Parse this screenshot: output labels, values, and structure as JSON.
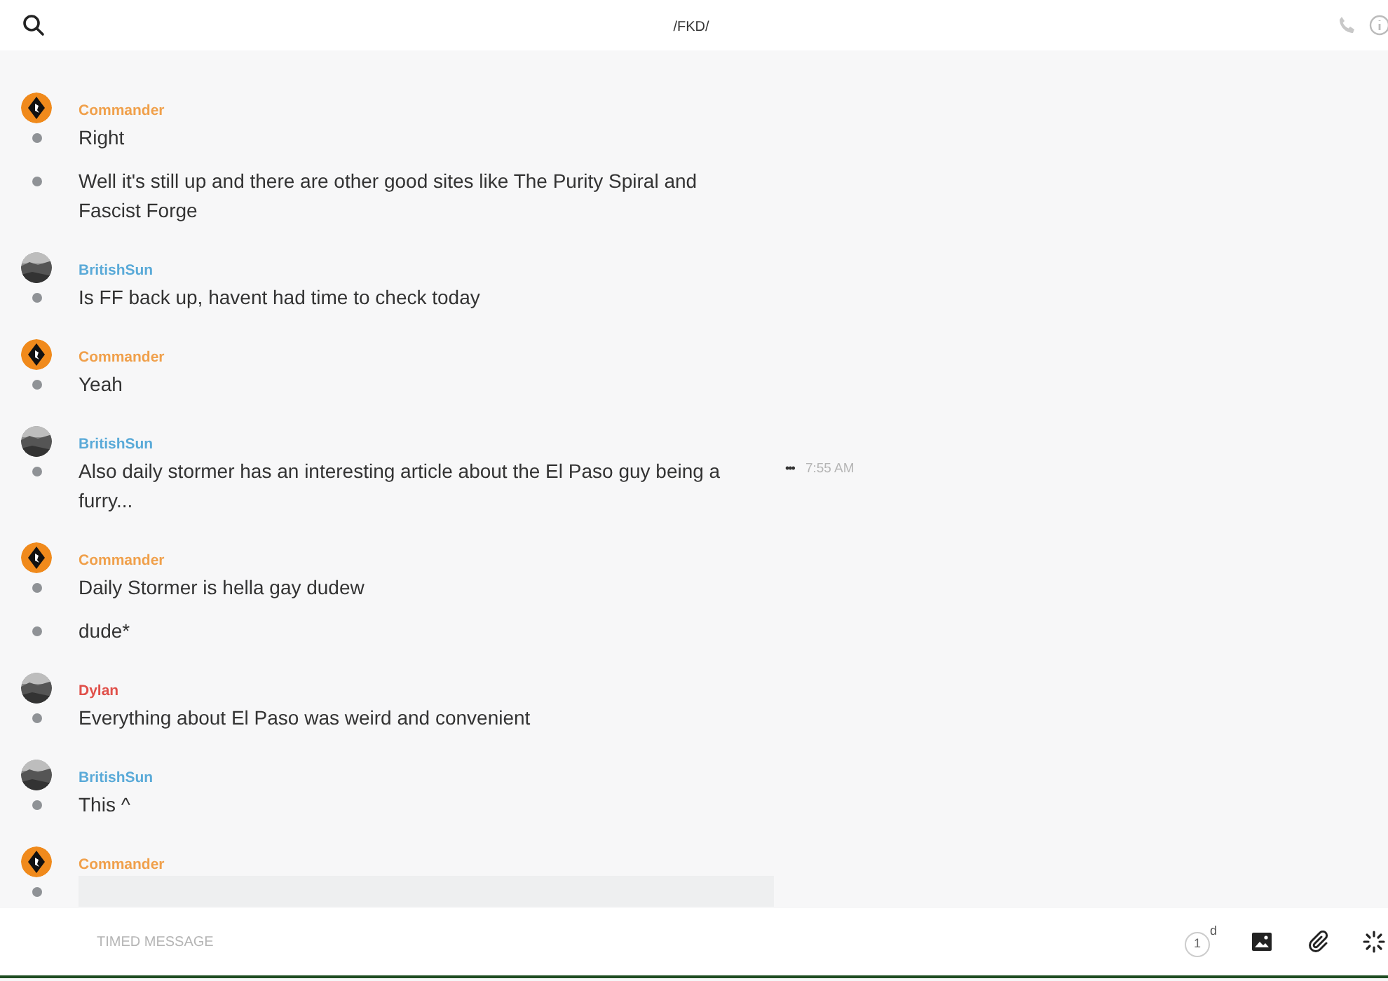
{
  "header": {
    "title": "/FKD/"
  },
  "groups": [
    {
      "author": "Commander",
      "color": "#f0a04b",
      "kind": "logo",
      "messages": [
        {
          "kind": "text",
          "text": "Right"
        },
        {
          "kind": "text",
          "text": "Well it's still up and there are other good sites like The Purity Spiral and Fascist Forge"
        }
      ]
    },
    {
      "author": "BritishSun",
      "color": "#5aaad8",
      "kind": "photo",
      "messages": [
        {
          "kind": "text",
          "text": "Is FF back up, havent had time to check today"
        }
      ]
    },
    {
      "author": "Commander",
      "color": "#f0a04b",
      "kind": "logo",
      "messages": [
        {
          "kind": "text",
          "text": "Yeah"
        }
      ]
    },
    {
      "author": "BritishSun",
      "color": "#5aaad8",
      "kind": "photo",
      "messages": [
        {
          "kind": "text",
          "text": "Also daily stormer has an interesting article about the El Paso guy being a furry...",
          "more": "•••",
          "time": "7:55 AM"
        }
      ]
    },
    {
      "author": "Commander",
      "color": "#f0a04b",
      "kind": "logo",
      "messages": [
        {
          "kind": "text",
          "text": "Daily Stormer is hella gay dudew"
        },
        {
          "kind": "text",
          "text": "dude*"
        }
      ]
    },
    {
      "author": "Dylan",
      "color": "#e0504a",
      "kind": "photo",
      "messages": [
        {
          "kind": "text",
          "text": "Everything about El Paso was weird and convenient"
        }
      ]
    },
    {
      "author": "BritishSun",
      "color": "#5aaad8",
      "kind": "photo",
      "messages": [
        {
          "kind": "text",
          "text": "This ^"
        }
      ]
    },
    {
      "author": "Commander",
      "color": "#f0a04b",
      "kind": "logo",
      "messages": [
        {
          "kind": "loading"
        }
      ]
    }
  ],
  "composer": {
    "placeholder": "TIMED MESSAGE",
    "timer": "1",
    "timer_unit": "d"
  }
}
